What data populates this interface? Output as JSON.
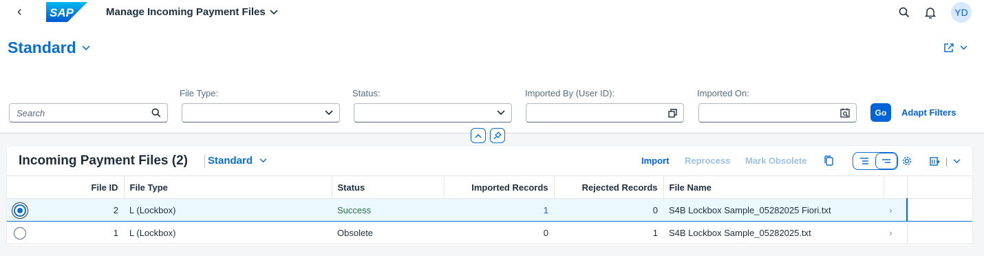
{
  "shell": {
    "app_title": "Manage Incoming Payment Files",
    "logo_text": "SAP",
    "avatar_initials": "YD"
  },
  "header": {
    "variant_title": "Standard"
  },
  "filters": {
    "search_placeholder": "Search",
    "file_type_label": "File Type:",
    "status_label": "Status:",
    "imported_by_label": "Imported By (User ID):",
    "imported_on_label": "Imported On:",
    "go_label": "Go",
    "adapt_label": "Adapt Filters"
  },
  "table": {
    "title": "Incoming Payment Files (2)",
    "variant": "Standard",
    "toolbar": {
      "import": "Import",
      "reprocess": "Reprocess",
      "mark_obsolete": "Mark Obsolete"
    },
    "columns": [
      "File ID",
      "File Type",
      "Status",
      "Imported Records",
      "Rejected Records",
      "File Name"
    ],
    "rows": [
      {
        "file_id": "2",
        "file_type": "L (Lockbox)",
        "status": "Success",
        "imported": "1",
        "rejected": "0",
        "file_name": "S4B Lockbox Sample_05282025 Fiori.txt"
      },
      {
        "file_id": "1",
        "file_type": "L (Lockbox)",
        "status": "Obsolete",
        "imported": "0",
        "rejected": "1",
        "file_name": "S4B Lockbox Sample_05282025.txt"
      }
    ]
  },
  "colors": {
    "brand": "#0a6ed1",
    "success": "#256f3a",
    "disabled": "#9ec1e8",
    "selected_row": "#ebf8ff"
  }
}
